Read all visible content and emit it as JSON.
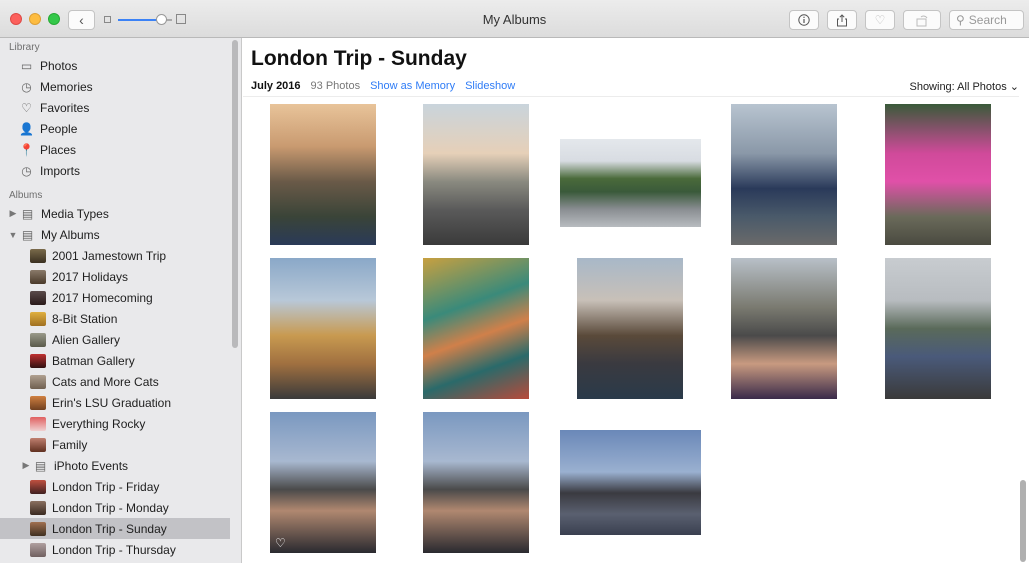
{
  "window": {
    "title": "My Albums"
  },
  "toolbar": {
    "back_icon": "chevron-left-icon",
    "info_icon": "info-icon",
    "share_icon": "share-icon",
    "favorite_icon": "heart-icon",
    "rotate_icon": "rotate-icon",
    "search_placeholder": "Search",
    "zoom_level": 0.8
  },
  "sidebar": {
    "library_heading": "Library",
    "library_items": [
      {
        "label": "Photos",
        "icon": "photos-icon"
      },
      {
        "label": "Memories",
        "icon": "memories-icon"
      },
      {
        "label": "Favorites",
        "icon": "heart-icon"
      },
      {
        "label": "People",
        "icon": "person-icon"
      },
      {
        "label": "Places",
        "icon": "pin-icon"
      },
      {
        "label": "Imports",
        "icon": "clock-icon"
      }
    ],
    "albums_heading": "Albums",
    "album_groups": [
      {
        "label": "Media Types",
        "icon": "folder-icon"
      },
      {
        "label": "My Albums",
        "icon": "folder-icon"
      }
    ],
    "albums": [
      {
        "label": "2001 Jamestown Trip"
      },
      {
        "label": "2017 Holidays"
      },
      {
        "label": "2017 Homecoming"
      },
      {
        "label": "8-Bit Station"
      },
      {
        "label": "Alien Gallery"
      },
      {
        "label": "Batman Gallery"
      },
      {
        "label": "Cats and More Cats"
      },
      {
        "label": "Erin's LSU Graduation"
      },
      {
        "label": "Everything Rocky"
      },
      {
        "label": "Family"
      },
      {
        "label": "iPhoto Events"
      },
      {
        "label": "London Trip - Friday"
      },
      {
        "label": "London Trip - Monday"
      },
      {
        "label": "London Trip - Sunday"
      },
      {
        "label": "London Trip - Thursday"
      }
    ],
    "selected_album": "London Trip - Sunday"
  },
  "main": {
    "album_title": "London Trip - Sunday",
    "date": "July 2016",
    "photo_count": "93 Photos",
    "show_as_memory": "Show as Memory",
    "slideshow": "Slideshow",
    "showing": "Showing: All Photos",
    "showing_chevron": "⌄"
  },
  "photos": [
    {
      "name": "photo-big-ben-street"
    },
    {
      "name": "photo-london-eye-pose"
    },
    {
      "name": "photo-thames-boat"
    },
    {
      "name": "photo-two-women-bridge"
    },
    {
      "name": "photo-pink-bus"
    },
    {
      "name": "photo-carousel-eye"
    },
    {
      "name": "photo-carousel-dragon"
    },
    {
      "name": "photo-big-ben-dusk"
    },
    {
      "name": "photo-selfie-big-ben"
    },
    {
      "name": "photo-two-women-river"
    },
    {
      "name": "photo-thumbs-up-1",
      "favorite": true
    },
    {
      "name": "photo-thumbs-up-2"
    },
    {
      "name": "photo-westminster-skyline"
    }
  ]
}
